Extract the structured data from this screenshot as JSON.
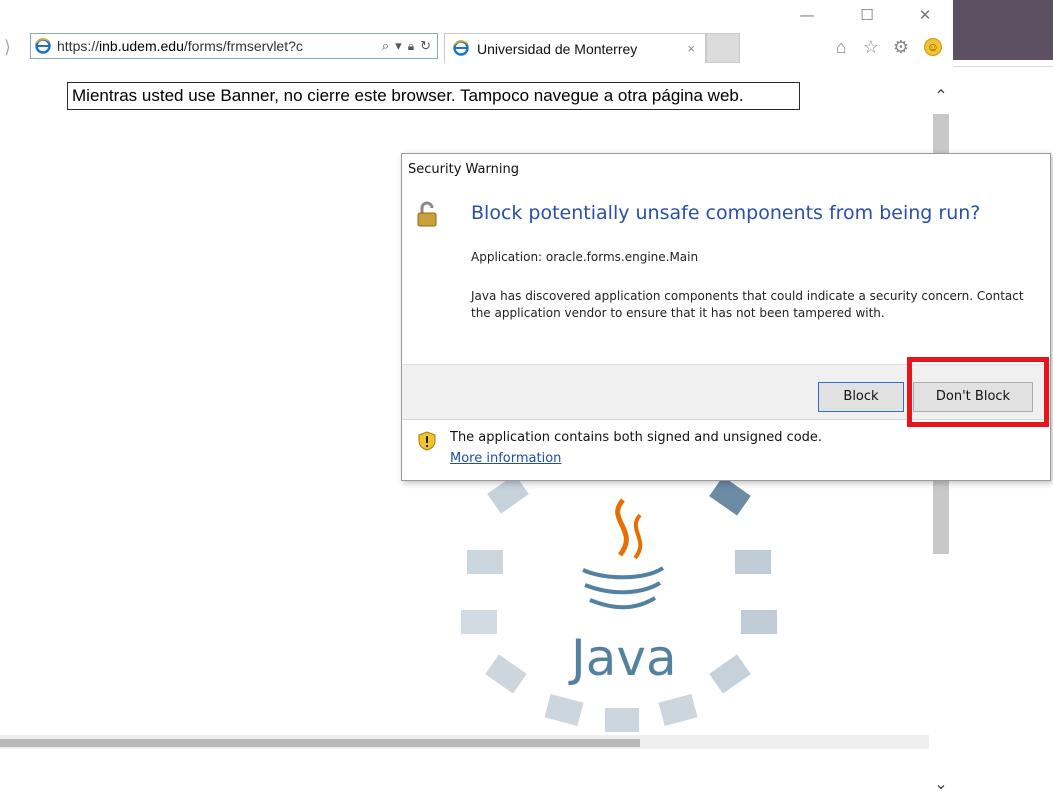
{
  "window": {
    "minimize": "—",
    "maximize": "☐",
    "close": "✕"
  },
  "address_bar": {
    "url_scheme": "https://",
    "url_domain": "inb.udem.edu",
    "url_path": "/forms/frmservlet?c",
    "search_glyph": "⌕",
    "dropdown_glyph": "▾",
    "lock_glyph": "🔒",
    "refresh_glyph": "↻"
  },
  "tab": {
    "title": "Universidad de Monterrey",
    "close": "×"
  },
  "toolbar_icons": [
    "home-icon",
    "favorites-star-icon",
    "settings-gear-icon",
    "feedback-smiley-icon"
  ],
  "page": {
    "notice": "Mientras usted use Banner, no cierre este browser. Tampoco navegue a otra página web."
  },
  "dialog": {
    "title": "Security Warning",
    "heading": "Block potentially unsafe components from being run?",
    "application_line": "Application: oracle.forms.engine.Main",
    "body": "Java has discovered application components that could indicate a security concern. Contact the application vendor to ensure that it has not been tampered with.",
    "block_button": "Block",
    "dont_block_button": "Don't Block",
    "footer_text": "The application contains both signed and unsigned code.",
    "more_info_link": "More information"
  },
  "java_logo_text": "Java",
  "colors": {
    "heading_blue": "#2a4fa8",
    "highlight_red": "#e8141b",
    "link_blue": "#1f4ea3",
    "accent_panel": "#5c5163"
  }
}
